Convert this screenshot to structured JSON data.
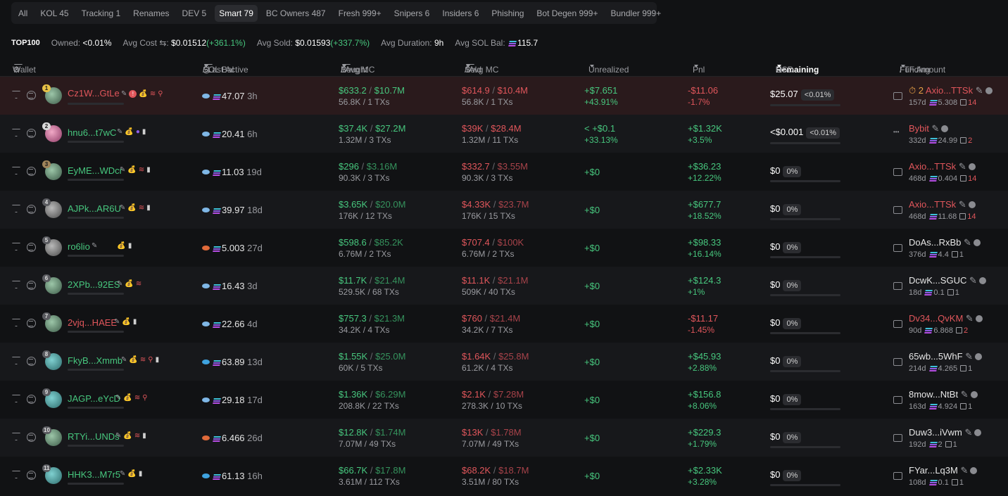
{
  "tabs": [
    "All",
    "KOL 45",
    "Tracking 1",
    "Renames",
    "DEV 5",
    "Smart 79",
    "BC Owners 487",
    "Fresh 999+",
    "Snipers 6",
    "Insiders 6",
    "Phishing",
    "Bot Degen 999+",
    "Bundler 999+"
  ],
  "active_tab": "Smart 79",
  "stats": {
    "top": "TOP100",
    "owned_label": "Owned:",
    "owned_value": "<0.01%",
    "avg_cost_label": "Avg Cost",
    "avg_cost_value": "$0.01512",
    "avg_cost_pct": "(+361.1%)",
    "avg_sold_label": "Avg Sold:",
    "avg_sold_value": "$0.01593",
    "avg_sold_pct": "(+337.7%)",
    "avg_duration_label": "Avg Duration:",
    "avg_duration_value": "9h",
    "avg_sol_label": "Avg SOL Bal:",
    "avg_sol_value": "115.7"
  },
  "headers": {
    "wallet": "Wallet",
    "sol_bal": "SOL Bal",
    "last_active": "/ Last Active",
    "bought": "Bought",
    "bought_mc": "/ Avg MC",
    "sold": "Sold",
    "sold_mc": "/ Avg MC",
    "unrealized": "Unrealized",
    "pnl": "Pnl",
    "remaining": "Remaining",
    "usd": "USD",
    "funding": "Funding",
    "tf_amount": "/ TF Amount"
  },
  "rows": [
    {
      "rank": "1",
      "wallet": "Cz1W...GtLe",
      "sol": "47.07",
      "active": "3h",
      "bought": "$633.2",
      "bought_mc": "$10.7M",
      "bought_sub": "56.8K / 1 TXs",
      "sold": "$614.9",
      "sold_mc": "$10.4M",
      "sold_sub": "56.8K / 1 TXs",
      "unreal": "+$7.651",
      "unreal_pct": "+43.91%",
      "pnl": "-$11.06",
      "pnl_pct": "-1.7%",
      "remain": "$25.07",
      "remain_pct": "<0.01%",
      "fund_prefix": "2",
      "fund": "Axio...TTSk",
      "fund_age": "157d",
      "fund_amt": "5.308",
      "fund_cnt": "14"
    },
    {
      "rank": "2",
      "wallet": "hnu6...t7wC",
      "sol": "20.41",
      "active": "6h",
      "bought": "$37.4K",
      "bought_mc": "$27.2M",
      "bought_sub": "1.32M / 3 TXs",
      "sold": "$39K",
      "sold_mc": "$28.4M",
      "sold_sub": "1.32M / 11 TXs",
      "unreal": "< +$0.1",
      "unreal_pct": "+33.13%",
      "pnl": "+$1.32K",
      "pnl_pct": "+3.5%",
      "remain": "<$0.001",
      "remain_pct": "<0.01%",
      "fund": "Bybit",
      "fund_age": "332d",
      "fund_amt": "24.99",
      "fund_cnt": "2"
    },
    {
      "rank": "3",
      "wallet": "EyME...WDcr",
      "sol": "11.03",
      "active": "19d",
      "bought": "$296",
      "bought_mc": "$3.16M",
      "bought_sub": "90.3K / 3 TXs",
      "sold": "$332.7",
      "sold_mc": "$3.55M",
      "sold_sub": "90.3K / 3 TXs",
      "unreal": "+$0",
      "pnl": "+$36.23",
      "pnl_pct": "+12.22%",
      "remain": "$0",
      "remain_pct": "0%",
      "fund": "Axio...TTSk",
      "fund_age": "468d",
      "fund_amt": "0.404",
      "fund_cnt": "14"
    },
    {
      "rank": "4",
      "wallet": "AJPk...AR6U",
      "sol": "39.97",
      "active": "18d",
      "bought": "$3.65K",
      "bought_mc": "$20.0M",
      "bought_sub": "176K / 12 TXs",
      "sold": "$4.33K",
      "sold_mc": "$23.7M",
      "sold_sub": "176K / 15 TXs",
      "unreal": "+$0",
      "pnl": "+$677.7",
      "pnl_pct": "+18.52%",
      "remain": "$0",
      "remain_pct": "0%",
      "fund": "Axio...TTSk",
      "fund_age": "468d",
      "fund_amt": "11.68",
      "fund_cnt": "14"
    },
    {
      "rank": "5",
      "wallet": "ro6lio",
      "sol": "5.003",
      "active": "27d",
      "bought": "$598.6",
      "bought_mc": "$85.2K",
      "bought_sub": "6.76M / 2 TXs",
      "sold": "$707.4",
      "sold_mc": "$100K",
      "sold_sub": "6.76M / 2 TXs",
      "unreal": "+$0",
      "pnl": "+$98.33",
      "pnl_pct": "+16.14%",
      "remain": "$0",
      "remain_pct": "0%",
      "fund": "DoAs...RxBb",
      "fund_age": "376d",
      "fund_amt": "4.4",
      "fund_cnt": "1"
    },
    {
      "rank": "6",
      "wallet": "2XPb...92ES",
      "sol": "16.43",
      "active": "3d",
      "bought": "$11.7K",
      "bought_mc": "$21.4M",
      "bought_sub": "529.5K / 68 TXs",
      "sold": "$11.1K",
      "sold_mc": "$21.1M",
      "sold_sub": "509K / 40 TXs",
      "unreal": "+$0",
      "pnl": "+$124.3",
      "pnl_pct": "+1%",
      "remain": "$0",
      "remain_pct": "0%",
      "fund": "DcwK...SGUC",
      "fund_age": "18d",
      "fund_amt": "0.1",
      "fund_cnt": "1"
    },
    {
      "rank": "7",
      "wallet": "2vjq...HAEE",
      "sol": "22.66",
      "active": "4d",
      "bought": "$757.3",
      "bought_mc": "$21.3M",
      "bought_sub": "34.2K / 4 TXs",
      "sold": "$760",
      "sold_mc": "$21.4M",
      "sold_sub": "34.2K / 7 TXs",
      "unreal": "+$0",
      "pnl": "-$11.17",
      "pnl_pct": "-1.45%",
      "remain": "$0",
      "remain_pct": "0%",
      "fund": "Dv34...QvKM",
      "fund_age": "90d",
      "fund_amt": "6.868",
      "fund_cnt": "2"
    },
    {
      "rank": "8",
      "wallet": "FkyB...Xmmb",
      "sol": "63.89",
      "active": "13d",
      "bought": "$1.55K",
      "bought_mc": "$25.0M",
      "bought_sub": "60K / 5 TXs",
      "sold": "$1.64K",
      "sold_mc": "$25.8M",
      "sold_sub": "61.2K / 4 TXs",
      "unreal": "+$0",
      "pnl": "+$45.93",
      "pnl_pct": "+2.88%",
      "remain": "$0",
      "remain_pct": "0%",
      "fund": "65wb...5WhF",
      "fund_age": "214d",
      "fund_amt": "4.265",
      "fund_cnt": "1"
    },
    {
      "rank": "9",
      "wallet": "JAGP...eYcD",
      "sol": "29.18",
      "active": "17d",
      "bought": "$1.36K",
      "bought_mc": "$6.29M",
      "bought_sub": "208.8K / 22 TXs",
      "sold": "$2.1K",
      "sold_mc": "$7.28M",
      "sold_sub": "278.3K / 10 TXs",
      "unreal": "+$0",
      "pnl": "+$156.8",
      "pnl_pct": "+8.06%",
      "remain": "$0",
      "remain_pct": "0%",
      "fund": "8mow...NtBt",
      "fund_age": "163d",
      "fund_amt": "4.924",
      "fund_cnt": "1"
    },
    {
      "rank": "10",
      "wallet": "RTYi...UNDs",
      "sol": "6.466",
      "active": "26d",
      "bought": "$12.8K",
      "bought_mc": "$1.74M",
      "bought_sub": "7.07M / 49 TXs",
      "sold": "$13K",
      "sold_mc": "$1.78M",
      "sold_sub": "7.07M / 49 TXs",
      "unreal": "+$0",
      "pnl": "+$229.3",
      "pnl_pct": "+1.79%",
      "remain": "$0",
      "remain_pct": "0%",
      "fund": "Duw3...iVwm",
      "fund_age": "192d",
      "fund_amt": "2",
      "fund_cnt": "1"
    },
    {
      "rank": "11",
      "wallet": "HHK3...M7r5",
      "sol": "61.13",
      "active": "16h",
      "bought": "$66.7K",
      "bought_mc": "$17.8M",
      "bought_sub": "3.61M / 112 TXs",
      "sold": "$68.2K",
      "sold_mc": "$18.7M",
      "sold_sub": "3.51M / 80 TXs",
      "unreal": "+$0",
      "pnl": "+$2.33K",
      "pnl_pct": "+3.28%",
      "remain": "$0",
      "remain_pct": "0%",
      "fund": "FYar...Lq3M",
      "fund_age": "108d",
      "fund_amt": "0.1",
      "fund_cnt": "1"
    }
  ]
}
